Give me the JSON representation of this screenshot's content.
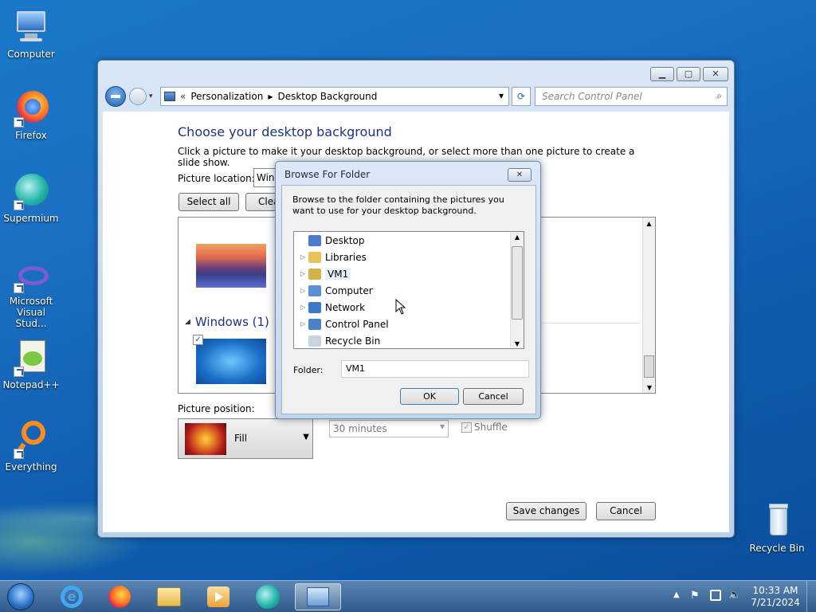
{
  "desktop": {
    "icons": [
      {
        "label": "Computer"
      },
      {
        "label": "Firefox"
      },
      {
        "label": "Supermium"
      },
      {
        "label": "Microsoft Visual Stud..."
      },
      {
        "label": "Notepad++"
      },
      {
        "label": "Everything"
      },
      {
        "label": "Recycle Bin"
      }
    ]
  },
  "window": {
    "controls": {
      "minimize": "▁",
      "maximize": "▢",
      "close": "✕"
    },
    "address": {
      "prefix": "«",
      "crumb1": "Personalization",
      "sep": "▶",
      "crumb2": "Desktop Background",
      "dropdown": "▾",
      "refresh": "⟳"
    },
    "search": {
      "placeholder": "Search Control Panel"
    },
    "heading": "Choose your desktop background",
    "subtitle": "Click a picture to make it your desktop background, or select more than one picture to create a slide show.",
    "picture_location_label": "Picture location:",
    "picture_location_value": "Win",
    "select_all": "Select all",
    "clear_all": "Clea",
    "group": {
      "arrow": "◢",
      "label": "Windows (1)"
    },
    "picture_position_label": "Picture position:",
    "picture_position_value": "Fill",
    "interval_value": "30 minutes",
    "shuffle_label": "Shuffle",
    "save_changes": "Save changes",
    "cancel": "Cancel"
  },
  "dialog": {
    "title": "Browse For Folder",
    "close": "✕",
    "instructions": "Browse to the folder containing the pictures you want to use for your desktop background.",
    "tree": [
      {
        "label": "Desktop",
        "expandable": false,
        "color": "#4a7cc9"
      },
      {
        "label": "Libraries",
        "expandable": true,
        "color": "#e8c35a"
      },
      {
        "label": "VM1",
        "expandable": true,
        "color": "#d6b34a",
        "selected": true
      },
      {
        "label": "Computer",
        "expandable": true,
        "color": "#5a8fd6"
      },
      {
        "label": "Network",
        "expandable": true,
        "color": "#3a7ac8"
      },
      {
        "label": "Control Panel",
        "expandable": true,
        "color": "#4b82c5"
      },
      {
        "label": "Recycle Bin",
        "expandable": false,
        "color": "#c8d4e0"
      }
    ],
    "folder_label": "Folder:",
    "folder_value": "VM1",
    "ok": "OK",
    "cancel": "Cancel"
  },
  "taskbar": {
    "pinned": [
      "start",
      "internet-explorer",
      "firefox",
      "explorer",
      "media-player",
      "supermium",
      "control-panel"
    ],
    "time": "10:33 AM",
    "date": "7/21/2024"
  }
}
